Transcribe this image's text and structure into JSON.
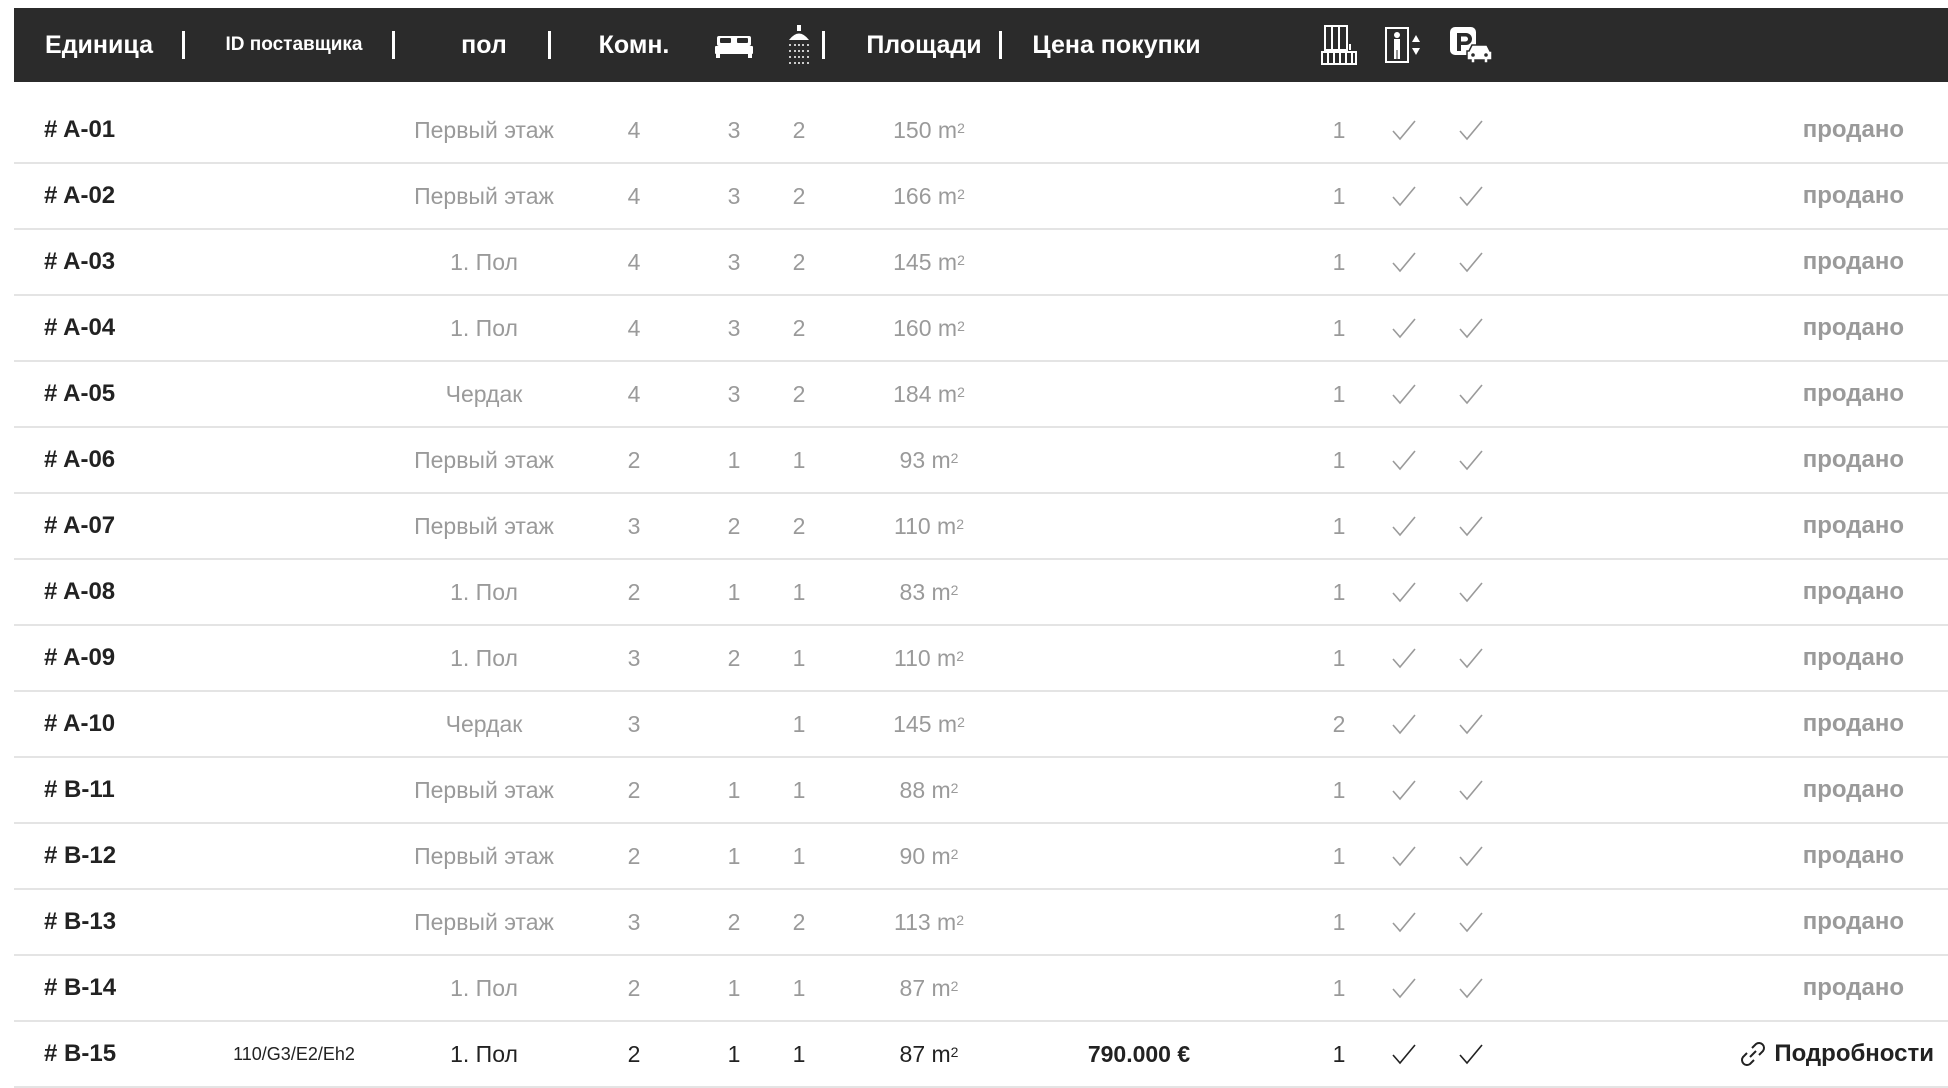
{
  "header": {
    "unit": "Единица",
    "vendor_id": "ID поставщика",
    "floor": "пол",
    "rooms": "Комн.",
    "area": "Площади",
    "price": "Цена покупки",
    "icons": [
      "bed-icon",
      "shower-icon",
      "building-floor-icon",
      "elevator-icon",
      "parking-icon"
    ]
  },
  "rows": [
    {
      "unit": "# A-01",
      "vendor_id": "",
      "floor": "Первый этаж",
      "rooms": "4",
      "bedrooms": "3",
      "baths": "2",
      "area": "150 m",
      "price": "",
      "level": "1",
      "elevator": true,
      "parking": true,
      "status": "продано"
    },
    {
      "unit": "# A-02",
      "vendor_id": "",
      "floor": "Первый этаж",
      "rooms": "4",
      "bedrooms": "3",
      "baths": "2",
      "area": "166 m",
      "price": "",
      "level": "1",
      "elevator": true,
      "parking": true,
      "status": "продано"
    },
    {
      "unit": "# A-03",
      "vendor_id": "",
      "floor": "1. Пол",
      "rooms": "4",
      "bedrooms": "3",
      "baths": "2",
      "area": "145 m",
      "price": "",
      "level": "1",
      "elevator": true,
      "parking": true,
      "status": "продано"
    },
    {
      "unit": "# A-04",
      "vendor_id": "",
      "floor": "1. Пол",
      "rooms": "4",
      "bedrooms": "3",
      "baths": "2",
      "area": "160 m",
      "price": "",
      "level": "1",
      "elevator": true,
      "parking": true,
      "status": "продано"
    },
    {
      "unit": "# A-05",
      "vendor_id": "",
      "floor": "Чердак",
      "rooms": "4",
      "bedrooms": "3",
      "baths": "2",
      "area": "184 m",
      "price": "",
      "level": "1",
      "elevator": true,
      "parking": true,
      "status": "продано"
    },
    {
      "unit": "# A-06",
      "vendor_id": "",
      "floor": "Первый этаж",
      "rooms": "2",
      "bedrooms": "1",
      "baths": "1",
      "area": "93 m",
      "price": "",
      "level": "1",
      "elevator": true,
      "parking": true,
      "status": "продано"
    },
    {
      "unit": "# A-07",
      "vendor_id": "",
      "floor": "Первый этаж",
      "rooms": "3",
      "bedrooms": "2",
      "baths": "2",
      "area": "110 m",
      "price": "",
      "level": "1",
      "elevator": true,
      "parking": true,
      "status": "продано"
    },
    {
      "unit": "# A-08",
      "vendor_id": "",
      "floor": "1. Пол",
      "rooms": "2",
      "bedrooms": "1",
      "baths": "1",
      "area": "83 m",
      "price": "",
      "level": "1",
      "elevator": true,
      "parking": true,
      "status": "продано"
    },
    {
      "unit": "# A-09",
      "vendor_id": "",
      "floor": "1. Пол",
      "rooms": "3",
      "bedrooms": "2",
      "baths": "1",
      "area": "110 m",
      "price": "",
      "level": "1",
      "elevator": true,
      "parking": true,
      "status": "продано"
    },
    {
      "unit": "# A-10",
      "vendor_id": "",
      "floor": "Чердак",
      "rooms": "3",
      "bedrooms": "",
      "baths": "1",
      "area": "145 m",
      "price": "",
      "level": "2",
      "elevator": true,
      "parking": true,
      "status": "продано"
    },
    {
      "unit": "# B-11",
      "vendor_id": "",
      "floor": "Первый этаж",
      "rooms": "2",
      "bedrooms": "1",
      "baths": "1",
      "area": "88 m",
      "price": "",
      "level": "1",
      "elevator": true,
      "parking": true,
      "status": "продано"
    },
    {
      "unit": "# B-12",
      "vendor_id": "",
      "floor": "Первый этаж",
      "rooms": "2",
      "bedrooms": "1",
      "baths": "1",
      "area": "90 m",
      "price": "",
      "level": "1",
      "elevator": true,
      "parking": true,
      "status": "продано"
    },
    {
      "unit": "# B-13",
      "vendor_id": "",
      "floor": "Первый этаж",
      "rooms": "3",
      "bedrooms": "2",
      "baths": "2",
      "area": "113 m",
      "price": "",
      "level": "1",
      "elevator": true,
      "parking": true,
      "status": "продано"
    },
    {
      "unit": "# B-14",
      "vendor_id": "",
      "floor": "1. Пол",
      "rooms": "2",
      "bedrooms": "1",
      "baths": "1",
      "area": "87 m",
      "price": "",
      "level": "1",
      "elevator": true,
      "parking": true,
      "status": "продано"
    },
    {
      "unit": "# B-15",
      "vendor_id": "110/G3/E2/Eh2",
      "floor": "1. Пол",
      "rooms": "2",
      "bedrooms": "1",
      "baths": "1",
      "area": "87 m",
      "price": "790.000 €",
      "level": "1",
      "elevator": true,
      "parking": true,
      "status": "Подробности",
      "active": true
    }
  ],
  "area_unit_sup": "2",
  "colors": {
    "header_bg": "#2b2b2b",
    "muted_text": "#9a9a9a",
    "active_text": "#222222",
    "divider": "#e4e4e4"
  }
}
